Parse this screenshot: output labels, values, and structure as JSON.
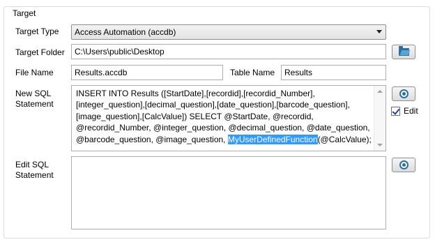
{
  "group": {
    "title": "Target"
  },
  "target_type": {
    "label": "Target Type",
    "value": "Access Automation (accdb)"
  },
  "target_folder": {
    "label": "Target Folder",
    "value": "C:\\Users\\public\\Desktop",
    "browse_icon": "folder-open-icon"
  },
  "file_name": {
    "label": "File Name",
    "value": "Results.accdb"
  },
  "table_name": {
    "label": "Table Name",
    "value": "Results"
  },
  "new_sql": {
    "label_line1": "New SQL",
    "label_line2": "Statement",
    "text_before": "INSERT INTO Results ([StartDate],[recordid],[recordid_Number],[integer_question],[decimal_question],[date_question],[barcode_question],[image_question],[CalcValue]) SELECT @StartDate, @recordid, @recordid_Number, @integer_question, @decimal_question, @date_question, @barcode_question, @image_question, ",
    "text_selected": "MyUserDefinedFunction",
    "text_after": "(@CalcValue);",
    "view_icon": "eye-icon",
    "edit_checkbox_label": "Edit",
    "edit_checked": true
  },
  "edit_sql": {
    "label_line1": "Edit SQL",
    "label_line2": "Statement",
    "value": "",
    "view_icon": "eye-icon"
  },
  "colors": {
    "selection": "#3399ff",
    "icon_blue": "#2d6ea5"
  }
}
